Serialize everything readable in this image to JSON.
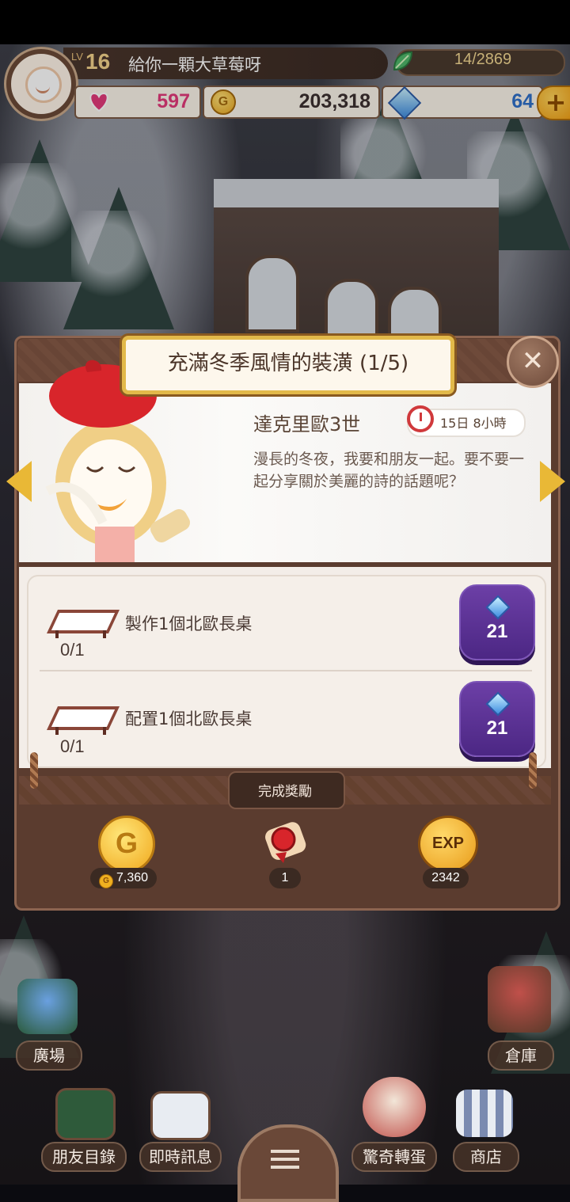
{
  "player": {
    "lv_label": "LV",
    "level": "16",
    "name": "給你一顆大草莓呀",
    "leaf_count": "14/2869"
  },
  "resources": {
    "hearts": "597",
    "coins": "203,318",
    "gems": "64",
    "coin_glyph": "G",
    "plus_glyph": "+"
  },
  "quest": {
    "title": "充滿冬季風情的裝潢 (1/5)",
    "close_glyph": "✕",
    "npc_name": "達克里歐3世",
    "timer": "15日 8小時",
    "dialog": "漫長的冬夜，我要和朋友一起。要不要一起分享關於美麗的詩的話題呢？",
    "tasks": [
      {
        "label": "製作1個北歐長桌",
        "progress": "0/1",
        "reward": "21"
      },
      {
        "label": "配置1個北歐長桌",
        "progress": "0/1",
        "reward": "21"
      }
    ],
    "complete_label": "完成獎勵",
    "rewards": {
      "coins": "7,360",
      "scroll": "1",
      "exp": "2342",
      "exp_label": "EXP",
      "coin_glyph": "G"
    }
  },
  "hud": {
    "plaza": "廣場",
    "storage": "倉庫",
    "friends": "朋友目錄",
    "messages": "即時訊息",
    "gacha": "驚奇轉蛋",
    "shop": "商店"
  },
  "colors": {
    "gold": "#e9b836",
    "purple_button": "#5a2f94",
    "frame_brown": "#5b3c2f",
    "heart_pink": "#e23a7a"
  }
}
